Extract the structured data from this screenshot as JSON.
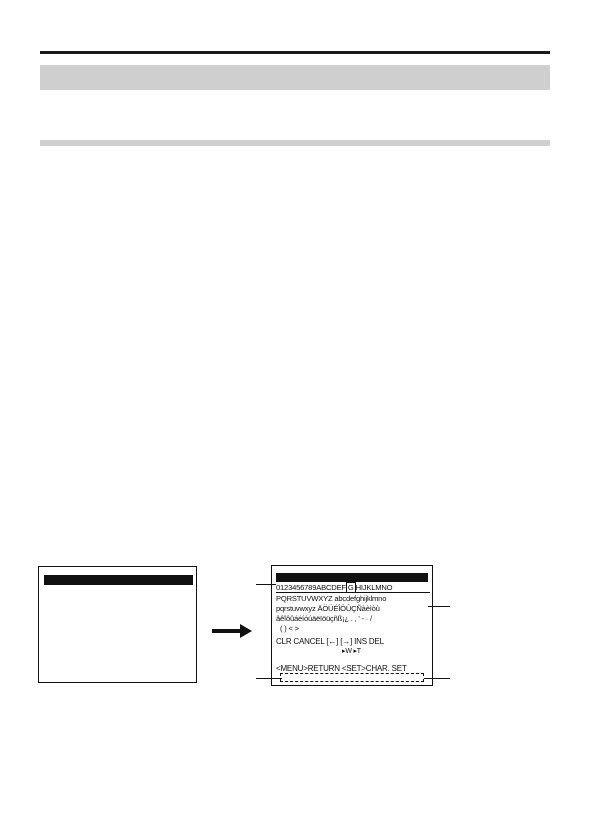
{
  "screen_right": {
    "row1": "0123456789ABCDEF",
    "row1_highlight": "G",
    "row1_rest": "HIJKLMNO",
    "row2": "PQRSTUVWXYZ abcdefghijklmno",
    "row3": "pqrstuvwxyz ÄÖÜÉÎÔÛÇÑàèìòù",
    "row4": "âêîôûáéíóúäëïöüçñß¡¿ . , ' - · /",
    "row5": "( ) < >",
    "controls": "CLR CANCEL  [←]  [→]  INS  DEL",
    "controls_sub": "▸W   ▸T",
    "footer": "<MENU>RETURN <SET>CHAR. SET"
  }
}
